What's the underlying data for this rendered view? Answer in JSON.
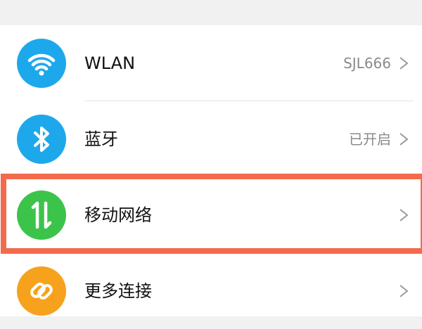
{
  "colors": {
    "wlan_icon": "#1ea8ec",
    "bluetooth_icon": "#1ea8ec",
    "mobile_network_icon": "#3cc44a",
    "more_connections_icon": "#f7a21c",
    "highlight": "#f36a4c"
  },
  "settings": {
    "items": [
      {
        "label": "WLAN",
        "value": "SJL666",
        "icon": "wifi-icon"
      },
      {
        "label": "蓝牙",
        "value": "已开启",
        "icon": "bluetooth-icon"
      },
      {
        "label": "移动网络",
        "value": "",
        "icon": "mobile-data-icon"
      },
      {
        "label": "更多连接",
        "value": "",
        "icon": "link-icon"
      }
    ]
  }
}
